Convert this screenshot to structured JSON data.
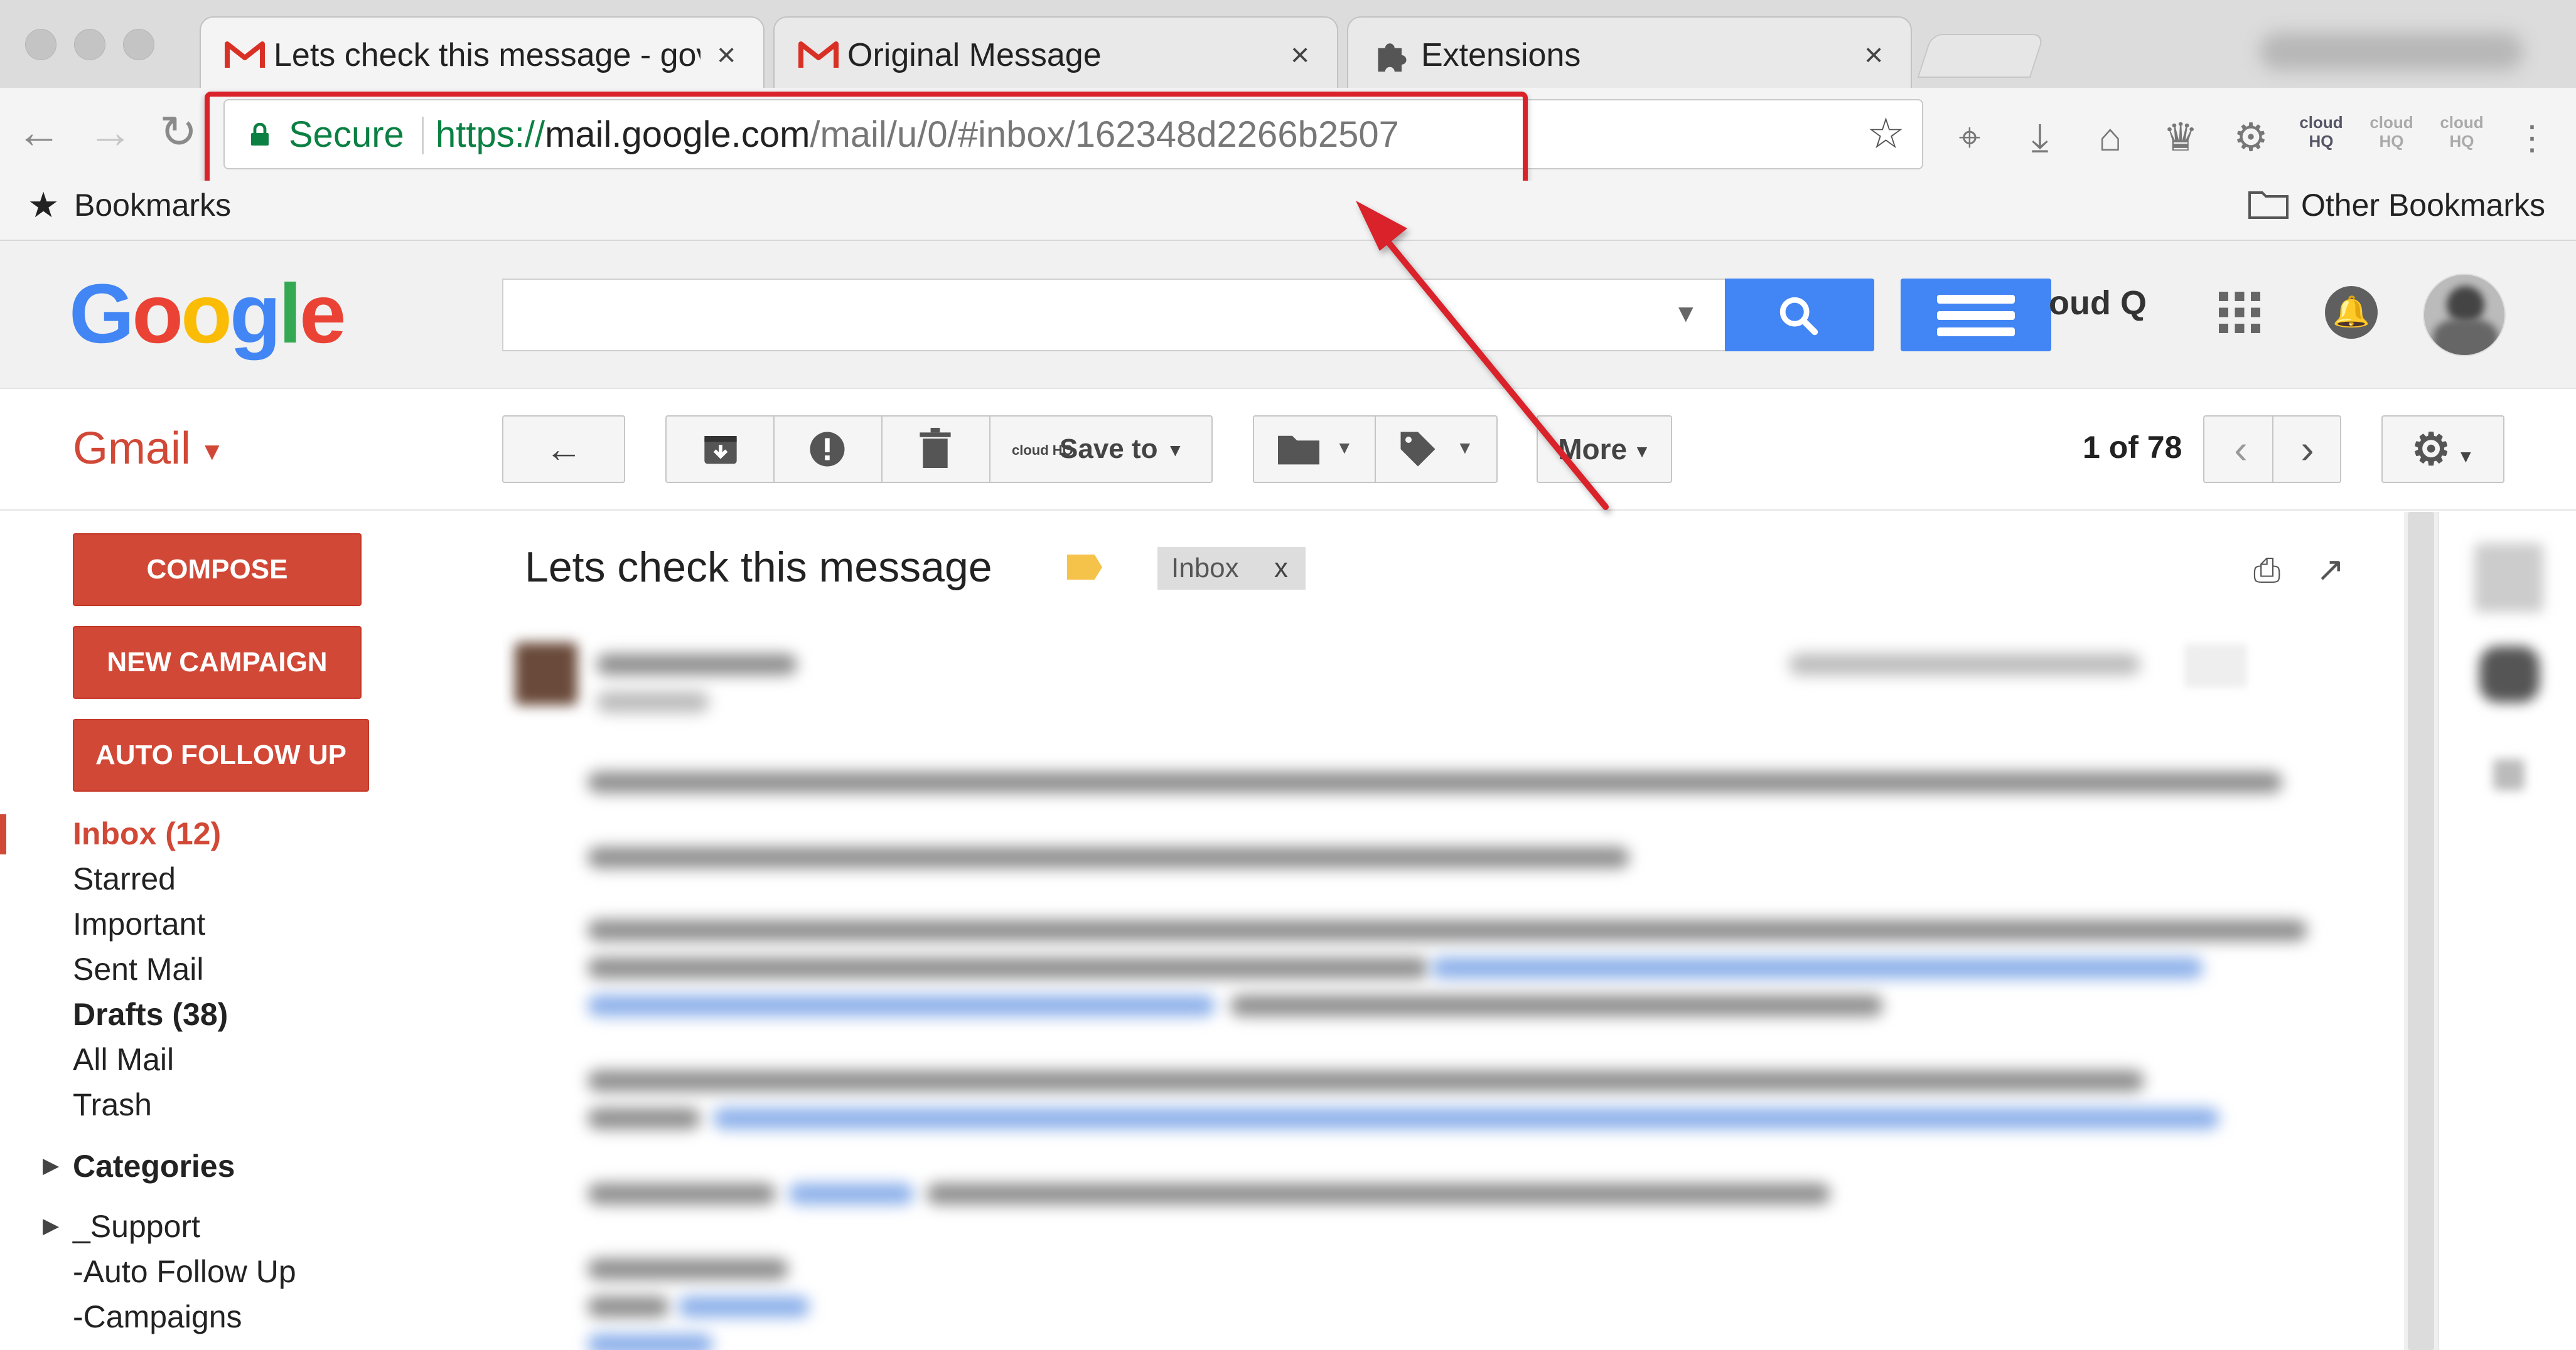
{
  "tabs": [
    {
      "title": "Lets check this message - gov",
      "icon": "gmail-m-icon",
      "close": "×"
    },
    {
      "title": "Original Message",
      "icon": "gmail-m-icon",
      "close": "×"
    },
    {
      "title": "Extensions",
      "icon": "puzzle-icon",
      "close": "×"
    }
  ],
  "address_bar": {
    "secure_label": "Secure",
    "url_scheme": "https://",
    "url_host": "mail.google.com",
    "url_path": "/mail/u/0/#inbox/162348d2266b2507"
  },
  "bookmarks_bar": {
    "bookmarks_label": "Bookmarks",
    "other_label": "Other Bookmarks"
  },
  "header": {
    "logo": "Google",
    "cloudhq_logo": "oud Q"
  },
  "toolbar": {
    "gmail_label": "Gmail",
    "save_to_label": "Save to",
    "more_label": "More",
    "page_count": "1 of 78",
    "cloudhq_mini": "cloud HQ"
  },
  "sidebar": {
    "compose": "COMPOSE",
    "new_campaign": "NEW CAMPAIGN",
    "auto_follow_up": "AUTO FOLLOW UP",
    "items": [
      {
        "label": "Inbox (12)"
      },
      {
        "label": "Starred"
      },
      {
        "label": "Important"
      },
      {
        "label": "Sent Mail"
      },
      {
        "label": "Drafts (38)"
      },
      {
        "label": "All Mail"
      },
      {
        "label": "Trash"
      },
      {
        "label": "Categories"
      },
      {
        "label": "_Support"
      },
      {
        "label": "-Auto Follow Up"
      },
      {
        "label": "-Campaigns"
      }
    ]
  },
  "message": {
    "subject": "Lets check this message",
    "label_chip": "Inbox",
    "label_remove": "x"
  },
  "colors": {
    "gmail_red": "#d14836",
    "google_blue": "#4285f4",
    "secure_green": "#0b8043",
    "annotation_red": "#d9222a"
  }
}
